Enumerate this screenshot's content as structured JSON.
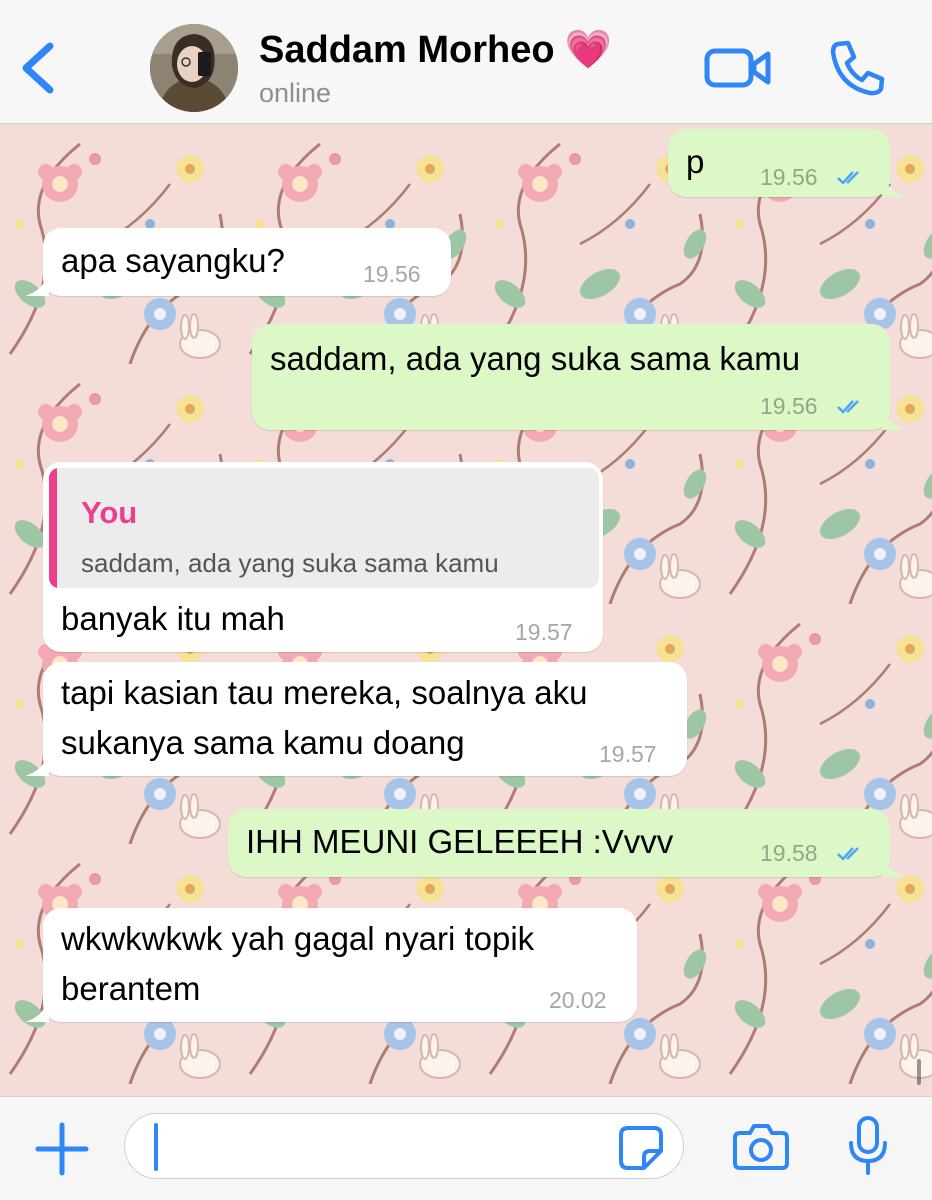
{
  "header": {
    "contact_name": "Saddam Morheo",
    "heart_emoji": "💗",
    "status": "online",
    "icons": [
      "chevron-left-icon",
      "video-camera-icon",
      "phone-icon"
    ]
  },
  "messages": [
    {
      "direction": "outgoing",
      "text": "p",
      "time": "19.56",
      "read": true
    },
    {
      "direction": "incoming",
      "text": "apa sayangku?",
      "time": "19.56"
    },
    {
      "direction": "outgoing",
      "text": "saddam, ada yang suka sama kamu",
      "time": "19.56",
      "read": true
    },
    {
      "direction": "incoming",
      "quote_author": "You",
      "quote_text": "saddam, ada yang suka sama kamu",
      "text": "banyak itu mah",
      "time": "19.57"
    },
    {
      "direction": "incoming",
      "lines": [
        "tapi kasian tau mereka, soalnya aku",
        "sukanya sama kamu doang"
      ],
      "time": "19.57"
    },
    {
      "direction": "outgoing",
      "text": "IHH MEUNI GELEEEH :Vvvv",
      "time": "19.58",
      "read": true
    },
    {
      "direction": "incoming",
      "lines": [
        "wkwkwkwk yah gagal nyari topik",
        "berantem"
      ],
      "time": "20.02"
    }
  ],
  "input_bar": {
    "value": "",
    "icons": [
      "plus-icon",
      "sticker-icon",
      "camera-icon",
      "microphone-icon"
    ]
  },
  "colors": {
    "accent": "#2f86f6",
    "outgoing_bubble": "#dcf8c6",
    "incoming_bubble": "#ffffff",
    "quote_accent": "#ee3d8f",
    "wallpaper": "#f4dcd8"
  }
}
